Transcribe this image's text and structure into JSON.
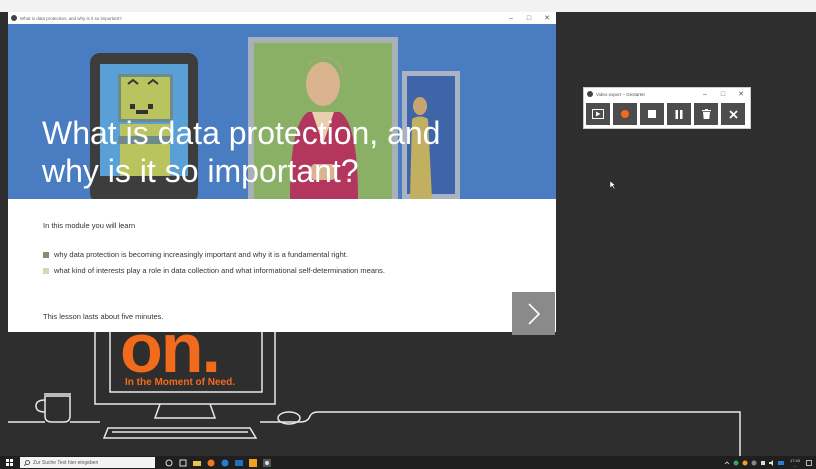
{
  "main_window": {
    "title": "What is data protection, and why is it so important?",
    "hero_title_line1": "What is data protection, and",
    "hero_title_line2": "why is it so important?",
    "lead": "In this module you will learn",
    "bullets": [
      "why data protection is becoming increasingly important and why it is a fundamental right.",
      "what kind of interests play a role in data collection and what informational self-determination means."
    ],
    "duration": "This lesson lasts about five minutes.",
    "next_icon": "chevron-right-icon"
  },
  "recorder": {
    "title": "Video export – Gestartet",
    "buttons": [
      "play-icon",
      "record-icon",
      "stop-icon",
      "pause-icon",
      "trash-icon",
      "close-icon"
    ]
  },
  "desktop": {
    "brand": "on.",
    "tagline": "In the Moment of Need."
  },
  "taskbar": {
    "search_placeholder": "Zur Suche Text hier eingeben",
    "time": "17:43",
    "date": "..."
  },
  "colors": {
    "hero_bg": "#4a7cc2",
    "brand_orange": "#f26b1d",
    "record_red": "#f26b1d"
  }
}
